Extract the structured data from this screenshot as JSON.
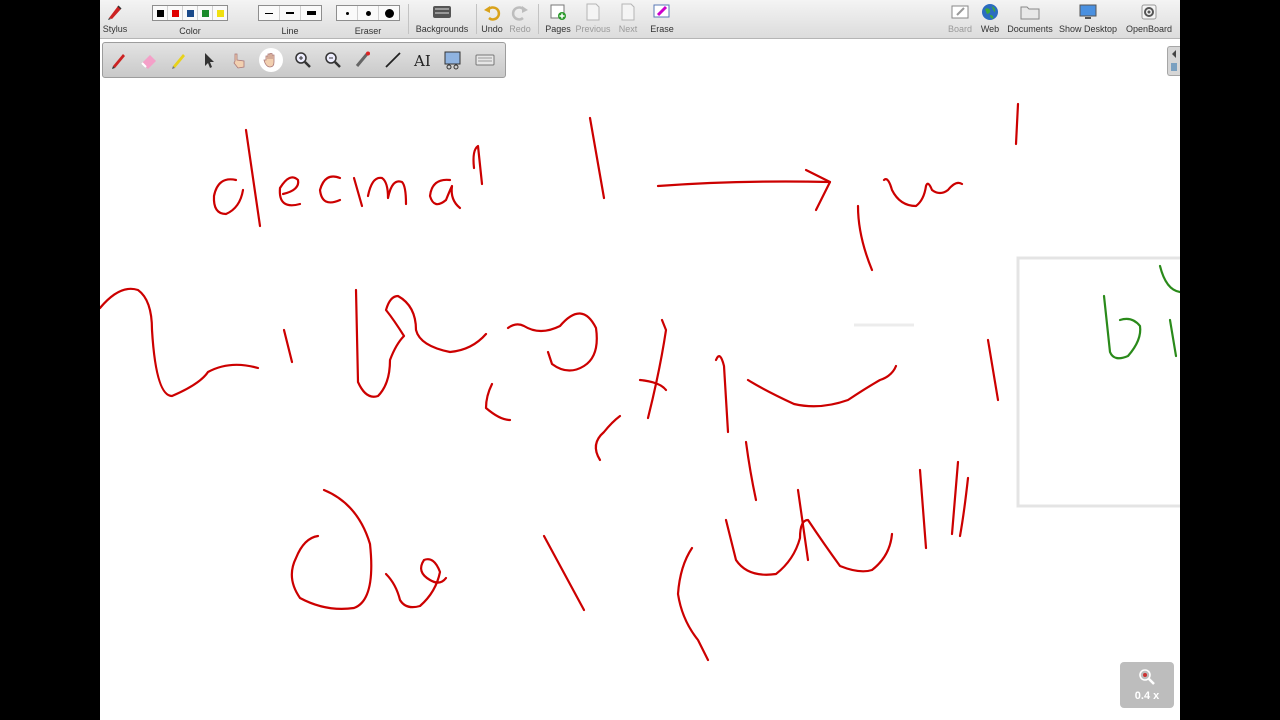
{
  "toolbar": {
    "stylus_label": "Stylus",
    "color_label": "Color",
    "line_label": "Line",
    "eraser_label": "Eraser",
    "backgrounds_label": "Backgrounds",
    "undo_label": "Undo",
    "redo_label": "Redo",
    "pages_label": "Pages",
    "previous_label": "Previous",
    "next_label": "Next",
    "erase_label": "Erase",
    "board_label": "Board",
    "web_label": "Web",
    "documents_label": "Documents",
    "show_desktop_label": "Show Desktop",
    "openboard_label": "OpenBoard"
  },
  "colors": {
    "swatches": [
      "#000000",
      "#e00000",
      "#1a4a8a",
      "#1a8a2a",
      "#f0e010"
    ],
    "ink_red": "#cc0000",
    "ink_green": "#2a8a1a"
  },
  "board": {
    "word": "decimal"
  },
  "zoom": {
    "label": "0.4 x"
  }
}
